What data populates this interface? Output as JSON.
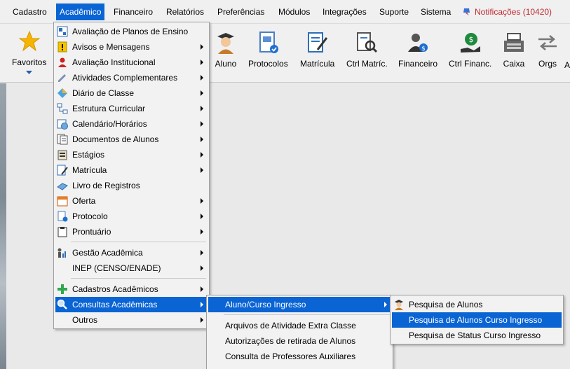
{
  "menubar": {
    "items": [
      "Cadastro",
      "Acadêmico",
      "Financeiro",
      "Relatórios",
      "Preferências",
      "Módulos",
      "Integrações",
      "Suporte",
      "Sistema"
    ],
    "notifications": "Notificações (10420)"
  },
  "toolbar": {
    "favoritos": "Favoritos",
    "buttons": [
      "Aluno",
      "Protocolos",
      "Matrícula",
      "Ctrl Matríc.",
      "Financeiro",
      "Ctrl Financ.",
      "Caixa",
      "Orgs",
      "A"
    ]
  },
  "academico_menu": {
    "items": [
      "Avaliação de Planos de Ensino",
      "Avisos e Mensagens",
      "Avaliação Institucional",
      "Atividades Complementares",
      "Diário de Classe",
      "Estrutura Curricular",
      "Calendário/Horários",
      "Documentos de Alunos",
      "Estágios",
      "Matrícula",
      "Livro de Registros",
      "Oferta",
      "Protocolo",
      "Prontuário",
      "Gestão Acadêmica",
      "INEP (CENSO/ENADE)",
      "Cadastros Acadêmicos",
      "Consultas Acadêmicas",
      "Outros"
    ]
  },
  "consultas_menu": {
    "items": [
      "Aluno/Curso Ingresso",
      "Arquivos de Atividade Extra Classe",
      "Autorizações de retirada de Alunos",
      "Consulta de Professores Auxiliares"
    ]
  },
  "aluno_menu": {
    "items": [
      "Pesquisa de Alunos",
      "Pesquisa de Alunos Curso Ingresso",
      "Pesquisa de Status Curso Ingresso"
    ]
  },
  "colors": {
    "highlight": "#0a64d4",
    "notification": "#c0272d"
  }
}
